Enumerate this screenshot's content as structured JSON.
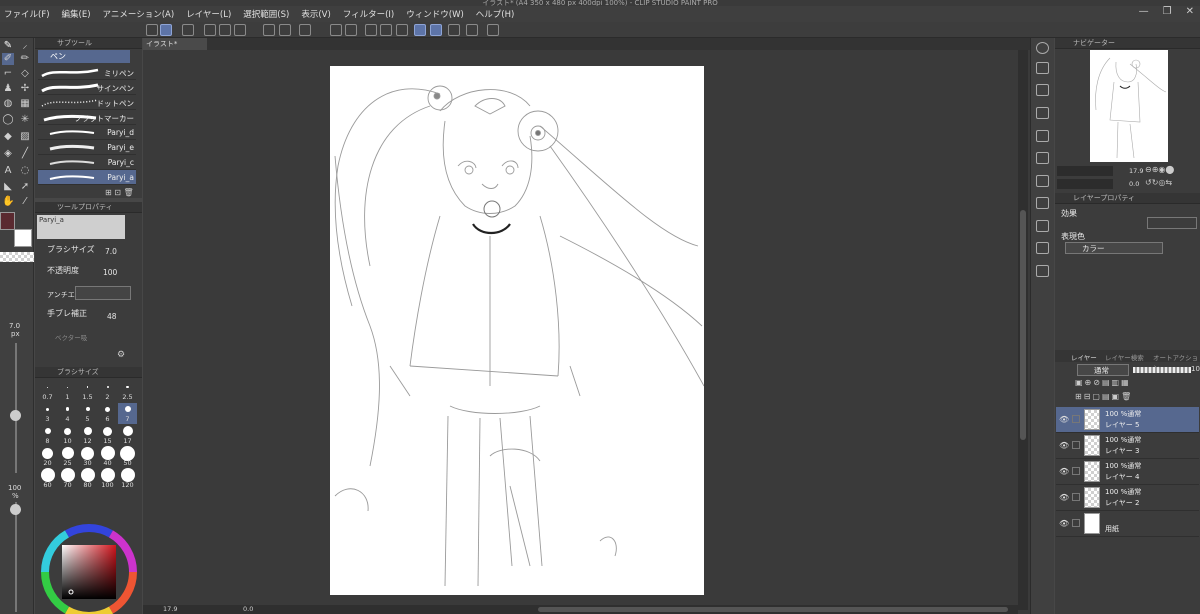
{
  "window": {
    "title": "イラスト* (A4 350 x 480 px 400dpi 100%) - CLIP STUDIO PAINT PRO"
  },
  "menu": [
    "ファイル(F)",
    "編集(E)",
    "アニメーション(A)",
    "レイヤー(L)",
    "選択範囲(S)",
    "表示(V)",
    "フィルター(I)",
    "ウィンドウ(W)",
    "ヘルプ(H)"
  ],
  "subtool": {
    "panel_title": "サブツール",
    "group": "ペン",
    "brushes": [
      "ミリペン",
      "サインペン",
      "ドットペン",
      "フラットマーカー",
      "Paryi_d",
      "Paryi_e",
      "Paryi_c",
      "Paryi_a"
    ],
    "selected_index": 7
  },
  "tool_property": {
    "panel_title": "ツールプロパティ",
    "preset_name": "Paryi_a",
    "brush_size_label": "ブラシサイズ",
    "brush_size_value": "7.0",
    "opacity_label": "不透明度",
    "opacity_value": "100",
    "antialias_label": "アンチエイリアス",
    "stabilization_label": "手ブレ補正",
    "stabilization_value": "48",
    "vector_label": "ベクター吸"
  },
  "brush_size_panel": {
    "panel_title": "ブラシサイズ",
    "sizes": [
      "0.7",
      "1",
      "1.5",
      "2",
      "2.5",
      "3",
      "4",
      "5",
      "6",
      "7",
      "8",
      "10",
      "12",
      "15",
      "17",
      "20",
      "25",
      "30",
      "40",
      "50",
      "60",
      "70",
      "80",
      "100",
      "120"
    ],
    "selected": "7"
  },
  "left_slider": {
    "size_value": "7.0",
    "size_unit": "px",
    "opacity_value": "100",
    "opacity_unit": "%"
  },
  "canvas": {
    "tab_label": "イラスト*"
  },
  "bottom_bar": {
    "zoom": "17.9",
    "angle": "0.0"
  },
  "navigator": {
    "panel_title": "ナビゲーター",
    "zoom": "17.9",
    "angle": "0.0"
  },
  "layer_property": {
    "panel_title": "レイヤープロパティ",
    "effect_label": "効果",
    "expression_label": "表現色",
    "expression_value": "カラー"
  },
  "layers_panel": {
    "tabs": [
      "レイヤー",
      "レイヤー検索",
      "オートアクション"
    ],
    "blend_mode": "通常",
    "opacity": "100",
    "items": [
      {
        "mode": "100 %通常",
        "name": "レイヤー 5",
        "selected": true,
        "type": "raster"
      },
      {
        "mode": "100 %通常",
        "name": "レイヤー 3",
        "selected": false,
        "type": "raster"
      },
      {
        "mode": "100 %通常",
        "name": "レイヤー 4",
        "selected": false,
        "type": "raster"
      },
      {
        "mode": "100 %通常",
        "name": "レイヤー 2",
        "selected": false,
        "type": "raster"
      },
      {
        "mode": "",
        "name": "用紙",
        "selected": false,
        "type": "paper"
      }
    ]
  },
  "colors": {
    "accent": "#56688f",
    "panel": "#3c3c3c",
    "canvas_bg": "#3a3a3a",
    "main_color": "#5a2a30"
  }
}
